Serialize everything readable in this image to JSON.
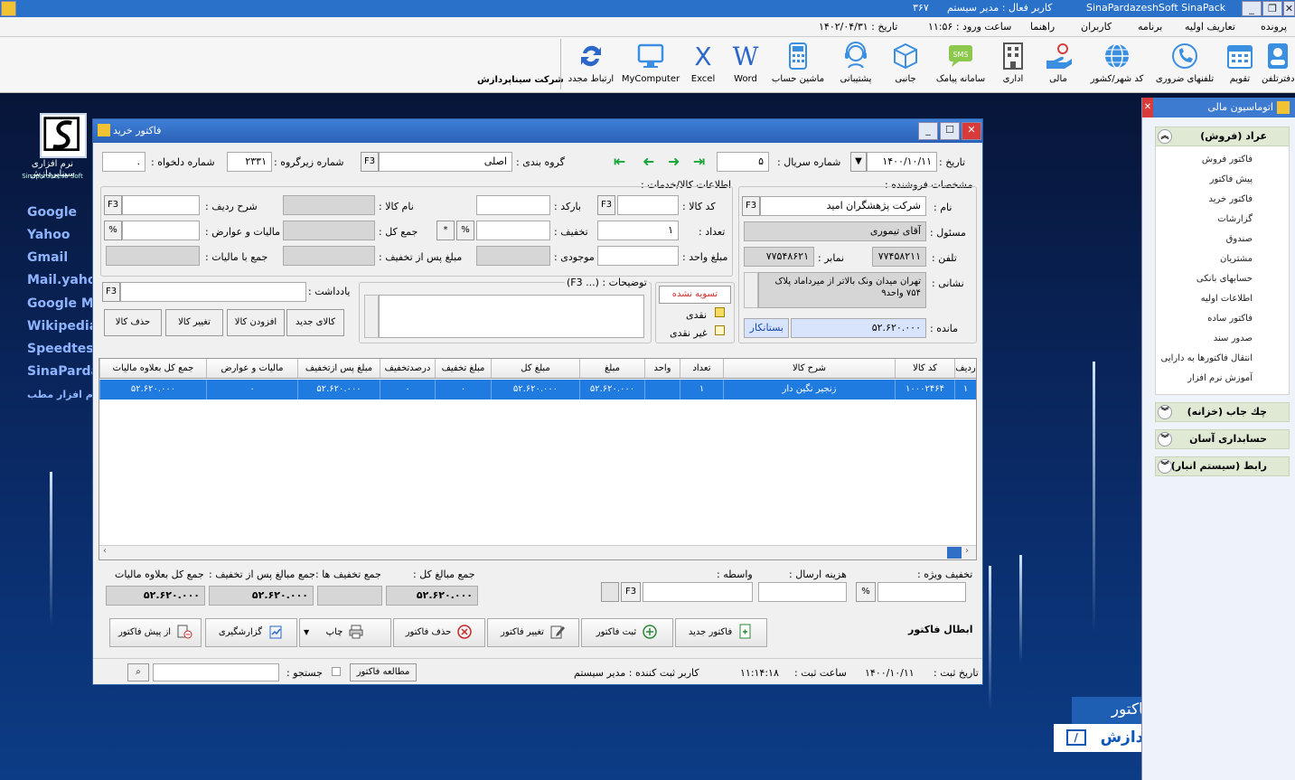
{
  "app": {
    "title": "SinaPardazeshSoft SinaPack",
    "active_user": "کاربر فعال : مدیر سیستم",
    "number": "۳۶۷"
  },
  "menu": {
    "items": [
      "پرونده",
      "تعاریف اولیه",
      "برنامه",
      "کاربران",
      "راهنما"
    ],
    "login_time": "ساعت ورود : ۱۱:۵۶",
    "date": "تاریخ : ۱۴۰۲/۰۴/۳۱"
  },
  "toolbar": {
    "company": "شرکت سیناپردازش",
    "tools": [
      {
        "label": "دفترتلفن",
        "icon": "phonebook-icon"
      },
      {
        "label": "تقویم",
        "icon": "calendar-icon"
      },
      {
        "label": "تلفنهای ضروری",
        "icon": "emergency-phones-icon"
      },
      {
        "label": "کد شهر/کشور",
        "icon": "globe-icon"
      },
      {
        "label": "مالی",
        "icon": "finance-icon"
      },
      {
        "label": "اداری",
        "icon": "building-icon"
      },
      {
        "label": "سامانه پیامک",
        "icon": "sms-icon"
      },
      {
        "label": "جانبی",
        "icon": "box-icon"
      },
      {
        "label": "پشتیبانی",
        "icon": "support-icon"
      },
      {
        "label": "ماشین حساب",
        "icon": "calculator-icon"
      },
      {
        "label": "Word",
        "icon": "word-icon"
      },
      {
        "label": "Excel",
        "icon": "excel-icon"
      },
      {
        "label": "MyComputer",
        "icon": "computer-icon"
      },
      {
        "label": "ارتباط مجدد",
        "icon": "reconnect-icon"
      }
    ]
  },
  "desktop": {
    "logo_text": "نرم افزاری سیناپردازش",
    "logo_sub": "Sinapardazesh Soft",
    "links": [
      "Google",
      "Yahoo",
      "Gmail",
      "Mail.yahoo",
      "Google M",
      "Wikipedia",
      "Speedtest",
      "SinaParda",
      "نرم افزار مطب"
    ],
    "banner_top": "نرم افزار صدور فاکتور",
    "banner_bottom": "نرم افزاری سیناپردازش"
  },
  "right_panel": {
    "title": "اتوماسیون مالی",
    "sections": [
      {
        "title": "عراد (فروش)",
        "expanded": true,
        "items": [
          "فاکتور فروش",
          "پیش فاکتور",
          "فاکتور خرید",
          "گزارشات",
          "صندوق",
          "مشتریان",
          "حسابهای بانکی",
          "اطلاعات اولیه",
          "فاکتور ساده",
          "صدور سند",
          "انتقال فاکتورها به دارایی",
          "آموزش نرم افزار"
        ]
      },
      {
        "title": "چك جاب (خزانه)",
        "expanded": false
      },
      {
        "title": "حسابداری آسان",
        "expanded": false
      },
      {
        "title": "رابط (سیستم انبار)",
        "expanded": false
      }
    ]
  },
  "dialog": {
    "title": "فاکتور خرید",
    "header": {
      "date_label": "تاریخ :",
      "date_value": "۱۴۰۰/۱۰/۱۱",
      "serial_label": "شماره سریال :",
      "serial_value": "۵",
      "group_label": "گروه بندی :",
      "group_value": "اصلی",
      "subgroup_label": "شماره زیرگروه :",
      "subgroup_value": "۲۳۳۱",
      "custom_label": "شماره دلخواه :",
      "custom_value": "."
    },
    "seller": {
      "section": "مشخصات فروشنده :",
      "name_label": "نام :",
      "name_value": "شرکت پژهشگران امید",
      "resp_label": "مسئول :",
      "resp_value": "آقای تیموری",
      "phone_label": "تلفن :",
      "phone_value": "۷۷۴۵۸۲۱۱",
      "fax_label": "نمابر :",
      "fax_value": "۷۷۵۴۸۶۲۱",
      "address_label": "نشانی :",
      "address_value": "تهران میدان ونک بالاتر از میرداماد پلاک ۷۵۴ واحد۹",
      "balance_label": "مانده :",
      "balance_value": "۵۲.۶۲۰.۰۰۰",
      "balance_status": "بستانکار"
    },
    "goods": {
      "section": "اطلاعات کالا/خدمات :",
      "code_label": "کد کالا :",
      "code_value": "",
      "barcode_label": "بارکد :",
      "name_label": "نام کالا :",
      "rowdesc_label": "شرح ردیف :",
      "qty_label": "تعداد :",
      "qty_value": "۱",
      "discount_label": "تخفیف :",
      "total_label": "جمع کل :",
      "tax_label": "مالیات و عوارض :",
      "unit_label": "مبلغ واحد :",
      "stock_label": "موجودی :",
      "after_disc_label": "مبلغ پس از تخفیف :",
      "with_tax_label": "جمع با مالیات :",
      "note_label": "یادداشت :",
      "desc_label": "توضیحات : (... F3)"
    },
    "buttons_small": {
      "new": "کالای جدید",
      "add": "افزودن کالا",
      "change": "تغییر کالا",
      "delete": "حذف کالا"
    },
    "payment": {
      "status": "تسویه نشده",
      "cash": "نقدی",
      "noncash": "غیر نقدی"
    },
    "grid": {
      "columns": [
        "ردیف",
        "کد کالا",
        "شرح کالا",
        "تعداد",
        "واحد",
        "مبلغ",
        "مبلغ کل",
        "مبلغ تخفیف",
        "درصدتخفیف",
        "مبلغ پس ازتخفیف",
        "مالیات و عوارض",
        "جمع کل بعلاوه مالیات"
      ],
      "rows": [
        [
          "۱",
          "۱۰۰۰۲۴۶۴",
          "زنجیر نگین دار",
          "۱",
          "",
          "۵۲.۶۲۰.۰۰۰",
          "۵۲.۶۲۰.۰۰۰",
          "۰",
          "۰",
          "۵۲.۶۲۰.۰۰۰",
          "۰",
          "۵۲.۶۲۰.۰۰۰"
        ]
      ]
    },
    "totals": {
      "special_disc_label": "تخفیف ویژه :",
      "shipping_label": "هزینه ارسال :",
      "broker_label": "واسطه :",
      "sum_label": "جمع مبالغ کل :",
      "sum_value": "۵۲.۶۲۰.۰۰۰",
      "disc_sum_label": "جمع تخفیف ها :",
      "disc_sum_value": "",
      "after_disc_sum_label": "جمع مبالغ پس از تخفیف :",
      "after_disc_sum_value": "۵۲.۶۲۰.۰۰۰",
      "grand_label": "جمع کل بعلاوه مالیات",
      "grand_value": "۵۲.۶۲۰.۰۰۰"
    },
    "actions": {
      "cancel": "ابطال فاکتور",
      "new": "فاکتور جدید",
      "save": "ثبت فاکتور",
      "edit": "تغییر فاکتور",
      "delete": "حذف فاکتور",
      "print": "چاپ",
      "report": "گزارشگیری",
      "from_pre": "از پیش فاکتور"
    },
    "status": {
      "reg_date_label": "تاریخ ثبت :",
      "reg_date": "۱۴۰۰/۱۰/۱۱",
      "reg_time_label": "ساعت ثبت :",
      "reg_time": "۱۱:۱۴:۱۸",
      "registrar": "کاربر ثبت کننده : مدیر سیستم",
      "browse": "مطالعه فاکتور",
      "search_label": "جستجو :"
    }
  },
  "colors": {
    "accent": "#2a72c9",
    "selection": "#1f7be0"
  }
}
